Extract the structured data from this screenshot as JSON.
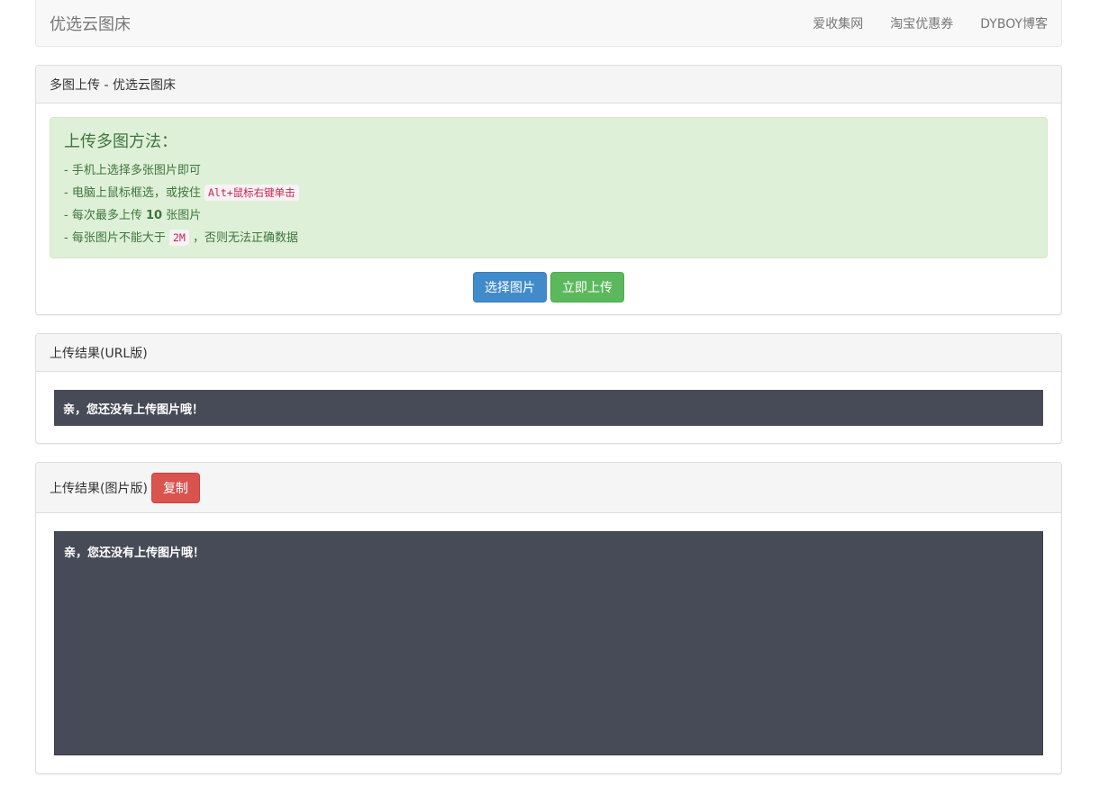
{
  "navbar": {
    "brand": "优选云图床",
    "links": [
      "爱收集网",
      "淘宝优惠券",
      "DYBOY博客"
    ]
  },
  "upload_panel": {
    "heading": "多图上传 - 优选云图床",
    "alert": {
      "title": "上传多图方法：",
      "line1": "- 手机上选择多张图片即可",
      "line2_prefix": "- 电脑上鼠标框选，或按住 ",
      "line2_code": "Alt+鼠标右键单击",
      "line3_prefix": "- 每次最多上传 ",
      "line3_bold": "10",
      "line3_suffix": " 张图片",
      "line4_prefix": "- 每张图片不能大于 ",
      "line4_code": "2M",
      "line4_suffix": " ，否则无法正确数据"
    },
    "select_button": "选择图片",
    "upload_button": "立即上传"
  },
  "url_panel": {
    "heading": "上传结果(URL版)",
    "result": "亲，您还没有上传图片哦！"
  },
  "img_panel": {
    "heading": "上传结果(图片版)",
    "copy_button": "复制",
    "result": "亲，您还没有上传图片哦！"
  },
  "colors": {
    "primary": "#428bca",
    "success": "#5cb85c",
    "danger": "#d9534f",
    "result_bg": "#474b57",
    "alert_bg": "#dff0d8"
  }
}
